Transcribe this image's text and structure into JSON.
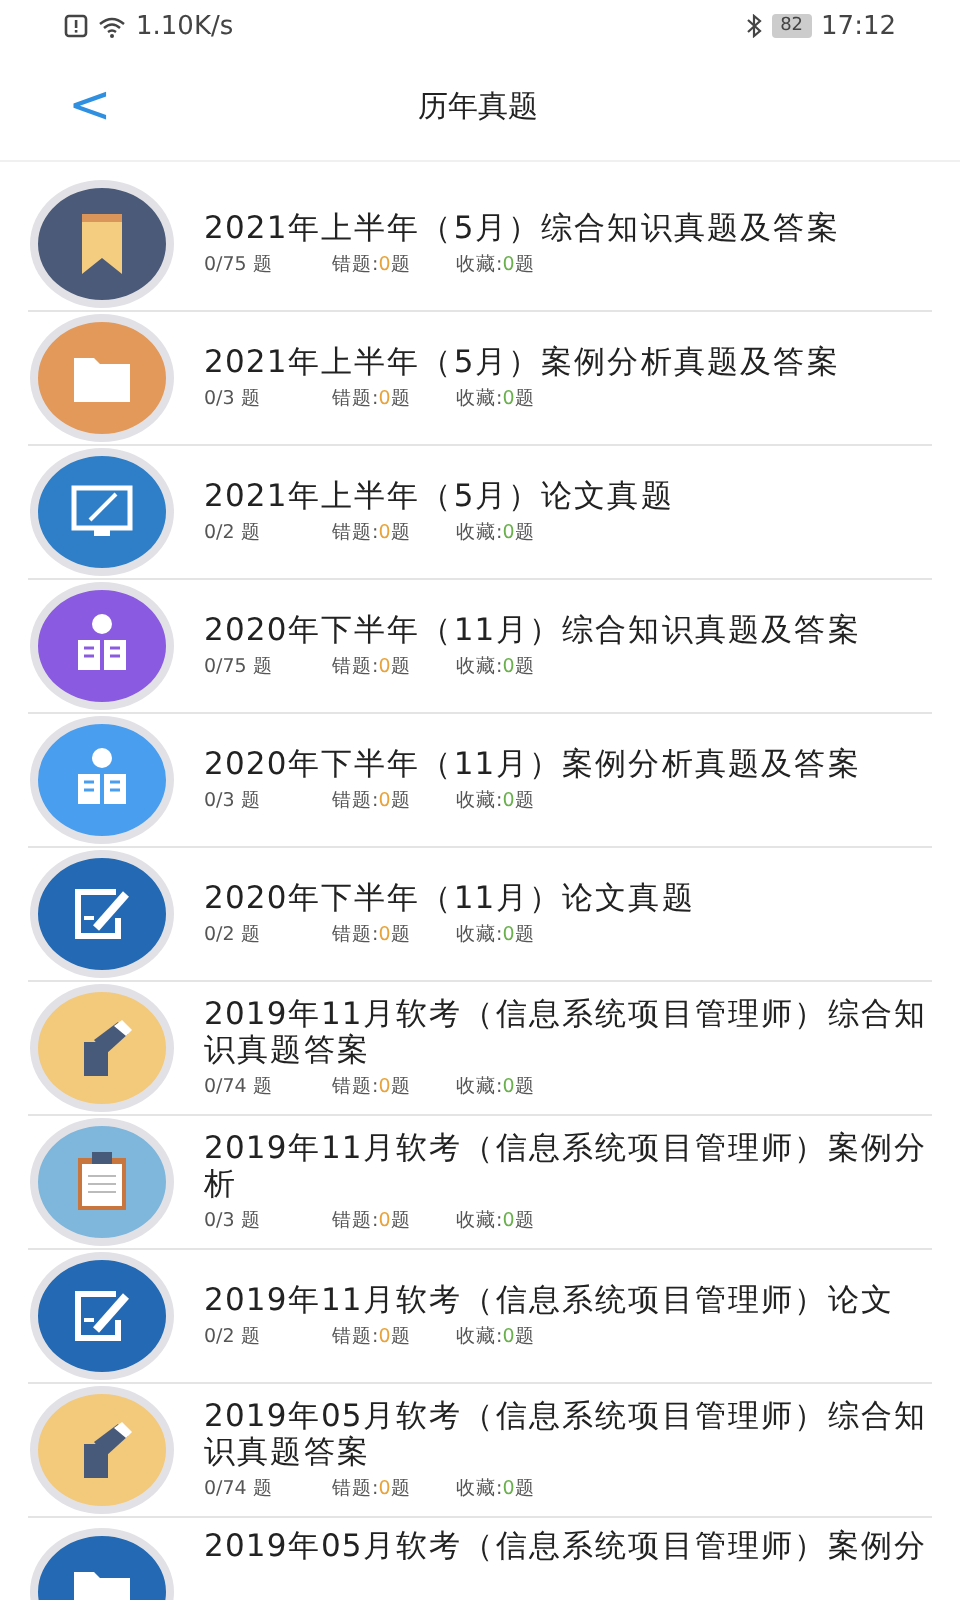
{
  "status_bar": {
    "speed": "1.10K/s",
    "battery": "82",
    "time": "17:12"
  },
  "header": {
    "back": "<",
    "title": "历年真题"
  },
  "items": [
    {
      "kind": "bookmark",
      "color": "#4a5a78",
      "title": "2021年上半年（5月）综合知识真题及答案",
      "progress": "0/75 题",
      "wrong": {
        "label": "错题:",
        "count": "0",
        "unit": "题"
      },
      "favorite": {
        "label": "收藏:",
        "count": "0",
        "unit": "题"
      }
    },
    {
      "kind": "folder",
      "color": "#e3995a",
      "title": "2021年上半年（5月）案例分析真题及答案",
      "progress": "0/3 题",
      "wrong": {
        "label": "错题:",
        "count": "0",
        "unit": "题"
      },
      "favorite": {
        "label": "收藏:",
        "count": "0",
        "unit": "题"
      }
    },
    {
      "kind": "monitor",
      "color": "#2f7fc8",
      "title": "2021年上半年（5月）论文真题",
      "progress": "0/2 题",
      "wrong": {
        "label": "错题:",
        "count": "0",
        "unit": "题"
      },
      "favorite": {
        "label": "收藏:",
        "count": "0",
        "unit": "题"
      }
    },
    {
      "kind": "reader",
      "color": "#8a5ae0",
      "title": " 2020年下半年（11月）综合知识真题及答案",
      "progress": "0/75 题",
      "wrong": {
        "label": "错题:",
        "count": "0",
        "unit": "题"
      },
      "favorite": {
        "label": "收藏:",
        "count": "0",
        "unit": "题"
      }
    },
    {
      "kind": "reader",
      "color": "#4a9ef0",
      "title": "2020年下半年（11月）案例分析真题及答案",
      "progress": "0/3 题",
      "wrong": {
        "label": "错题:",
        "count": "0",
        "unit": "题"
      },
      "favorite": {
        "label": "收藏:",
        "count": "0",
        "unit": "题"
      }
    },
    {
      "kind": "edit",
      "color": "#2369b4",
      "title": "2020年下半年（11月）论文真题",
      "progress": "0/2 题",
      "wrong": {
        "label": "错题:",
        "count": "0",
        "unit": "题"
      },
      "favorite": {
        "label": "收藏:",
        "count": "0",
        "unit": "题"
      }
    },
    {
      "kind": "pen",
      "color": "#f3c97c",
      "title": "2019年11月软考（信息系统项目管理师）综合知识真题答案",
      "progress": "0/74 题",
      "wrong": {
        "label": "错题:",
        "count": "0",
        "unit": "题"
      },
      "favorite": {
        "label": "收藏:",
        "count": "0",
        "unit": "题"
      }
    },
    {
      "kind": "clipboard",
      "color": "#7fb6dc",
      "title": "2019年11月软考（信息系统项目管理师）案例分析",
      "progress": "0/3 题",
      "wrong": {
        "label": "错题:",
        "count": "0",
        "unit": "题"
      },
      "favorite": {
        "label": "收藏:",
        "count": "0",
        "unit": "题"
      }
    },
    {
      "kind": "edit",
      "color": "#2369b4",
      "title": "2019年11月软考（信息系统项目管理师）论文",
      "progress": "0/2 题",
      "wrong": {
        "label": "错题:",
        "count": "0",
        "unit": "题"
      },
      "favorite": {
        "label": "收藏:",
        "count": "0",
        "unit": "题"
      }
    },
    {
      "kind": "pen",
      "color": "#f3c97c",
      "title": "2019年05月软考（信息系统项目管理师）综合知识真题答案",
      "progress": "0/74 题",
      "wrong": {
        "label": "错题:",
        "count": "0",
        "unit": "题"
      },
      "favorite": {
        "label": "收藏:",
        "count": "0",
        "unit": "题"
      }
    },
    {
      "kind": "folder",
      "color": "#2369b4",
      "title": "2019年05月软考（信息系统项目管理师）案例分"
    }
  ]
}
